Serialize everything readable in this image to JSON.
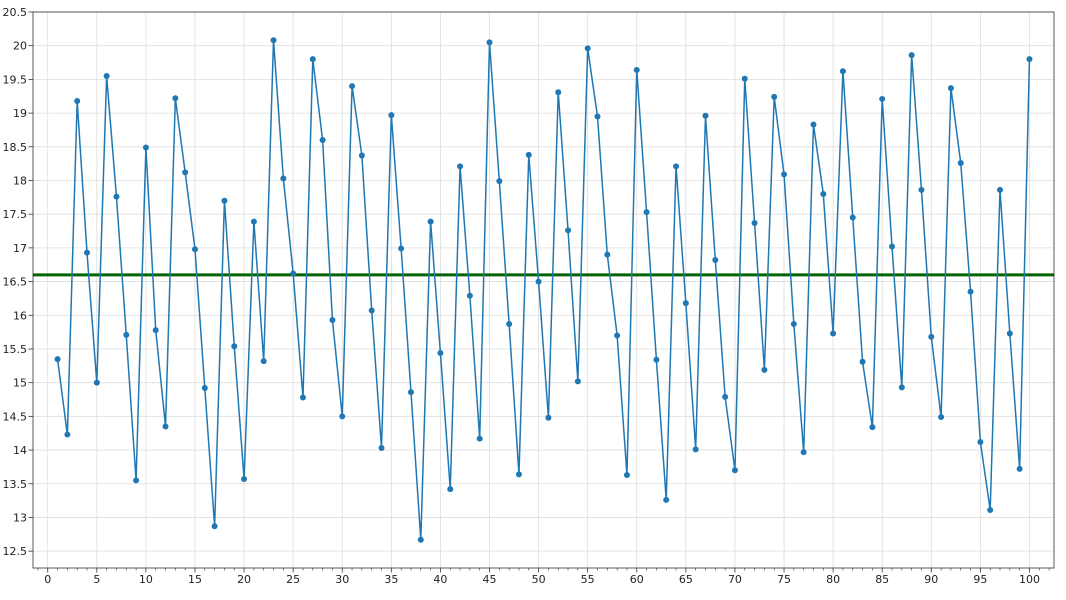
{
  "chart_data": {
    "type": "line",
    "title": "",
    "xlabel": "",
    "ylabel": "",
    "xlim": [
      -1.5,
      102.5
    ],
    "ylim": [
      12.25,
      20.5
    ],
    "grid": true,
    "x_ticks": [
      0,
      5,
      10,
      15,
      20,
      25,
      30,
      35,
      40,
      45,
      50,
      55,
      60,
      65,
      70,
      75,
      80,
      85,
      90,
      95,
      100
    ],
    "x_tick_labels": [
      "0",
      "5",
      "10",
      "15",
      "20",
      "25",
      "30",
      "35",
      "40",
      "45",
      "50",
      "55",
      "60",
      "65",
      "70",
      "75",
      "80",
      "85",
      "90",
      "95",
      "100"
    ],
    "y_ticks": [
      12.5,
      13,
      13.5,
      14,
      14.5,
      15,
      15.5,
      16,
      16.5,
      17,
      17.5,
      18,
      18.5,
      19,
      19.5,
      20,
      20.5
    ],
    "y_tick_labels": [
      "12.5",
      "13",
      "13.5",
      "14",
      "14.5",
      "15",
      "15.5",
      "16",
      "16.5",
      "17",
      "17.5",
      "18",
      "18.5",
      "19",
      "19.5",
      "20",
      "20.5"
    ],
    "x": [
      1,
      2,
      3,
      4,
      5,
      6,
      7,
      8,
      9,
      10,
      11,
      12,
      13,
      14,
      15,
      16,
      17,
      18,
      19,
      20,
      21,
      22,
      23,
      24,
      25,
      26,
      27,
      28,
      29,
      30,
      31,
      32,
      33,
      34,
      35,
      36,
      37,
      38,
      39,
      40,
      41,
      42,
      43,
      44,
      45,
      46,
      47,
      48,
      49,
      50,
      51,
      52,
      53,
      54,
      55,
      56,
      57,
      58,
      59,
      60,
      61,
      62,
      63,
      64,
      65,
      66,
      67,
      68,
      69,
      70,
      71,
      72,
      73,
      74,
      75,
      76,
      77,
      78,
      79,
      80,
      81,
      82,
      83,
      84,
      85,
      86,
      87,
      88,
      89,
      90,
      91,
      92,
      93,
      94,
      95,
      96,
      97,
      98,
      99,
      100
    ],
    "series": [
      {
        "values": [
          15.35,
          14.23,
          19.18,
          16.93,
          15.0,
          19.55,
          17.76,
          15.71,
          13.55,
          18.49,
          15.78,
          14.35,
          19.22,
          18.12,
          16.98,
          14.92,
          12.87,
          17.7,
          15.54,
          13.57,
          17.39,
          15.32,
          20.08,
          18.03,
          16.62,
          14.78,
          19.8,
          18.6,
          15.93,
          14.5,
          19.4,
          18.37,
          16.07,
          14.03,
          18.97,
          16.99,
          14.86,
          12.67,
          17.39,
          15.44,
          13.42,
          18.21,
          16.29,
          14.17,
          20.05,
          17.99,
          15.87,
          13.64,
          18.38,
          16.5,
          14.48,
          19.31,
          17.26,
          15.02,
          19.96,
          18.95,
          16.9,
          15.7,
          13.63,
          19.64,
          17.53,
          15.34,
          13.26,
          18.21,
          16.18,
          14.01,
          18.96,
          16.82,
          14.79,
          13.7,
          19.51,
          17.37,
          15.19,
          19.24,
          18.09,
          15.87,
          13.97,
          18.83,
          17.8,
          15.73,
          19.62,
          17.45,
          15.31,
          14.34,
          19.21,
          17.02,
          14.93,
          19.86,
          17.86,
          15.68,
          14.49,
          19.37,
          18.26,
          16.35,
          14.12,
          13.11,
          17.86,
          15.73,
          13.72,
          19.8
        ],
        "color": "#1f77b4"
      }
    ],
    "hline": {
      "value": 16.6,
      "color": "#006400"
    }
  }
}
